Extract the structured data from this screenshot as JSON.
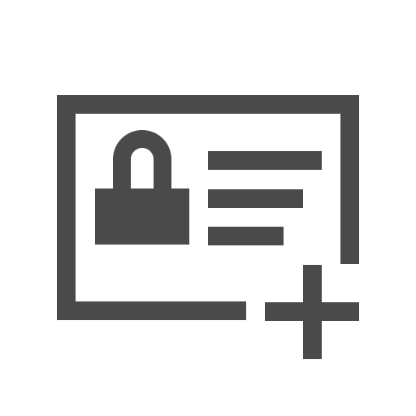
{
  "icon": {
    "name": "add-secure-credential-icon",
    "color": "#4a4a4a",
    "background": "#ffffff",
    "parts": [
      "card-frame",
      "lock-icon",
      "text-lines",
      "plus-icon"
    ]
  }
}
